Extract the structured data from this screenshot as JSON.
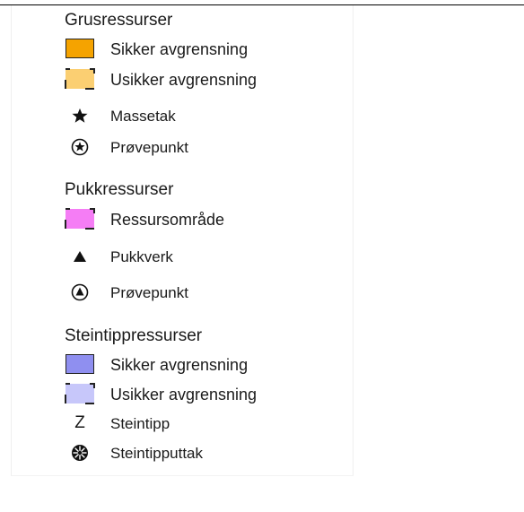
{
  "colors": {
    "gravel_certain": "#f5a300",
    "gravel_uncertain": "#fbcf72",
    "crushed_area": "#f57df5",
    "spoil_certain": "#8f8ff0",
    "spoil_uncertain": "#c7c7fa"
  },
  "legend": {
    "grus": {
      "heading": "Grusressurser",
      "items": [
        {
          "label": "Sikker avgrensning",
          "icon": "orange-solid-square"
        },
        {
          "label": "Usikker avgrensning",
          "icon": "orange-dashed-square"
        },
        {
          "label": "Massetak",
          "icon": "star-icon"
        },
        {
          "label": "Prøvepunkt",
          "icon": "circled-star-icon"
        }
      ]
    },
    "pukk": {
      "heading": "Pukkressurser",
      "items": [
        {
          "label": "Ressursområde",
          "icon": "pink-dashed-square"
        },
        {
          "label": "Pukkverk",
          "icon": "triangle-icon"
        },
        {
          "label": "Prøvepunkt",
          "icon": "circled-triangle-icon"
        }
      ]
    },
    "steintipp": {
      "heading": "Steintippressurser",
      "items": [
        {
          "label": "Sikker avgrensning",
          "icon": "blue-solid-square"
        },
        {
          "label": "Usikker avgrensning",
          "icon": "blue-dashed-square"
        },
        {
          "label": "Steintipp",
          "icon": "z-letter-icon",
          "symbol_text": "Z"
        },
        {
          "label": "Steintipputtak",
          "icon": "spoked-wheel-icon"
        }
      ]
    }
  }
}
